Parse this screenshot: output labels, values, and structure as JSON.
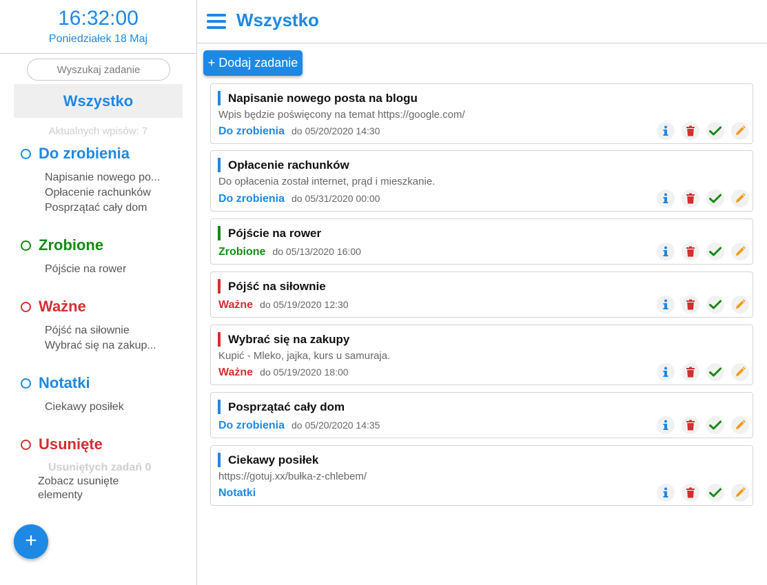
{
  "clock": {
    "time": "16:32:00",
    "date": "Poniedziałek 18 Maj"
  },
  "search": {
    "placeholder": "Wyszukaj zadanie"
  },
  "sidebar": {
    "all_label": "Wszystko",
    "active_count": "Aktualnych wpisów: 7",
    "categories": [
      {
        "label": "Do zrobienia",
        "color": "#1e88e5",
        "items": [
          "Napisanie nowego po...",
          "Opłacenie rachunków",
          "Posprzątać cały dom"
        ]
      },
      {
        "label": "Zrobione",
        "color": "#128c12",
        "items": [
          "Pójście na rower"
        ]
      },
      {
        "label": "Ważne",
        "color": "#d32f2f",
        "items": [
          "Pójść na siłownie",
          "Wybrać się na zakup..."
        ]
      },
      {
        "label": "Notatki",
        "color": "#1e88e5",
        "items": [
          "Ciekawy posiłek"
        ]
      },
      {
        "label": "Usunięte",
        "color": "#d32f2f",
        "items": []
      }
    ],
    "deleted_count": "Usuniętych zadań 0",
    "deleted_link": "Zobacz usunięte elementy",
    "fab_icon": "plus-icon"
  },
  "header": {
    "title": "Wszystko",
    "menu_icon": "hamburger-icon"
  },
  "add_button": "+ Dodaj zadanie",
  "tasks": [
    {
      "title": "Napisanie nowego posta na blogu",
      "desc": "Wpis będzie poświęcony na temat https://google.com/",
      "category": "Do zrobienia",
      "due": "do 05/20/2020 14:30",
      "color": "#1e88e5"
    },
    {
      "title": "Opłacenie rachunków",
      "desc": "Do opłacenia został internet, prąd i mieszkanie.",
      "category": "Do zrobienia",
      "due": "do 05/31/2020 00:00",
      "color": "#1e88e5"
    },
    {
      "title": "Pójście na rower",
      "desc": "",
      "category": "Zrobione",
      "due": "do 05/13/2020 16:00",
      "color": "#128c12"
    },
    {
      "title": "Pójść na siłownie",
      "desc": "",
      "category": "Ważne",
      "due": "do 05/19/2020 12:30",
      "color": "#d32f2f"
    },
    {
      "title": "Wybrać się na zakupy",
      "desc": "Kupić - Mleko, jajka, kurs u samuraja.",
      "category": "Ważne",
      "due": "do 05/19/2020 18:00",
      "color": "#d32f2f"
    },
    {
      "title": "Posprzątać cały dom",
      "desc": "",
      "category": "Do zrobienia",
      "due": "do 05/20/2020 14:35",
      "color": "#1e88e5"
    },
    {
      "title": "Ciekawy posiłek",
      "desc": "https://gotuj.xx/bułka-z-chlebem/",
      "category": "Notatki",
      "due": "",
      "color": "#1e88e5"
    }
  ],
  "action_icons": [
    "info-icon",
    "trash-icon",
    "check-icon",
    "pencil-icon"
  ],
  "colors": {
    "accent": "#1e88e5",
    "done": "#128c12",
    "important": "#d32f2f",
    "edit": "#f39c12"
  }
}
